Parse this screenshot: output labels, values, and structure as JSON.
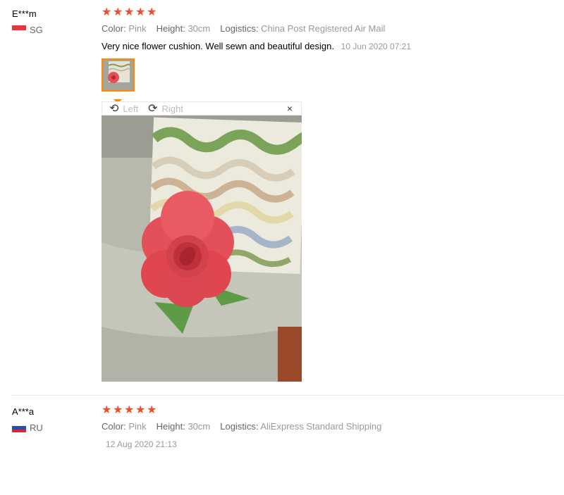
{
  "reviews": [
    {
      "user": "E***m",
      "country": "SG",
      "rating": 5,
      "attrs": [
        {
          "label": "Color:",
          "value": "Pink"
        },
        {
          "label": "Height:",
          "value": "30cm"
        },
        {
          "label": "Logistics:",
          "value": "China Post Registered Air Mail"
        }
      ],
      "content": "Very nice flower cushion. Well sewn and beautiful design.",
      "date": "10 Jun 2020 07:21"
    },
    {
      "user": "A***a",
      "country": "RU",
      "rating": 5,
      "attrs": [
        {
          "label": "Color:",
          "value": "Pink"
        },
        {
          "label": "Height:",
          "value": "30cm"
        },
        {
          "label": "Logistics:",
          "value": "AliExpress Standard Shipping"
        }
      ],
      "date": "12 Aug 2020 21:13"
    }
  ],
  "viewer": {
    "left_label": "Left",
    "right_label": "Right",
    "close_glyph": "×",
    "rotate_left_icon": "rotate-left-icon",
    "rotate_right_icon": "rotate-right-icon"
  },
  "colors": {
    "star": "#f04b2f",
    "thumb_border": "#ff8800"
  }
}
